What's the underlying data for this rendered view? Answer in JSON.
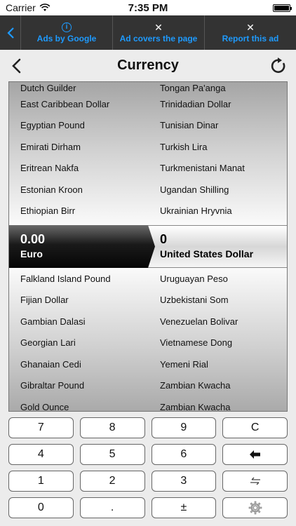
{
  "status": {
    "carrier": "Carrier",
    "time": "7:35 PM"
  },
  "ad": {
    "items": [
      {
        "icon": "i",
        "label": "Ads by Google"
      },
      {
        "icon": "✕",
        "label": "Ad covers the page"
      },
      {
        "icon": "✕",
        "label": "Report this ad"
      }
    ]
  },
  "nav": {
    "title": "Currency"
  },
  "list_top": [
    [
      "Dutch Guilder",
      "Tongan Pa'anga"
    ],
    [
      "East Caribbean Dollar",
      "Trinidadian Dollar"
    ],
    [
      "Egyptian Pound",
      "Tunisian Dinar"
    ],
    [
      "Emirati Dirham",
      "Turkish Lira"
    ],
    [
      "Eritrean Nakfa",
      "Turkmenistani Manat"
    ],
    [
      "Estonian Kroon",
      "Ugandan Shilling"
    ],
    [
      "Ethiopian Birr",
      "Ukrainian Hryvnia"
    ]
  ],
  "selected": {
    "from_value": "0.00",
    "from_name": "Euro",
    "to_value": "0",
    "to_name": "United States Dollar"
  },
  "list_bottom": [
    [
      "Falkland Island Pound",
      "Uruguayan Peso"
    ],
    [
      "Fijian Dollar",
      "Uzbekistani Som"
    ],
    [
      "Gambian Dalasi",
      "Venezuelan Bolivar"
    ],
    [
      "Georgian Lari",
      "Vietnamese Dong"
    ],
    [
      "Ghanaian Cedi",
      "Yemeni Rial"
    ],
    [
      "Gibraltar Pound",
      "Zambian Kwacha"
    ],
    [
      "Gold Ounce",
      "Zambian Kwacha"
    ]
  ],
  "keypad": [
    [
      "7",
      "8",
      "9",
      "C"
    ],
    [
      "4",
      "5",
      "6",
      "backspace-icon"
    ],
    [
      "1",
      "2",
      "3",
      "swap-icon"
    ],
    [
      "0",
      ".",
      "±",
      "gear-icon"
    ]
  ],
  "colors": {
    "ad_accent": "#1e9bff",
    "ad_bg": "#333333"
  }
}
